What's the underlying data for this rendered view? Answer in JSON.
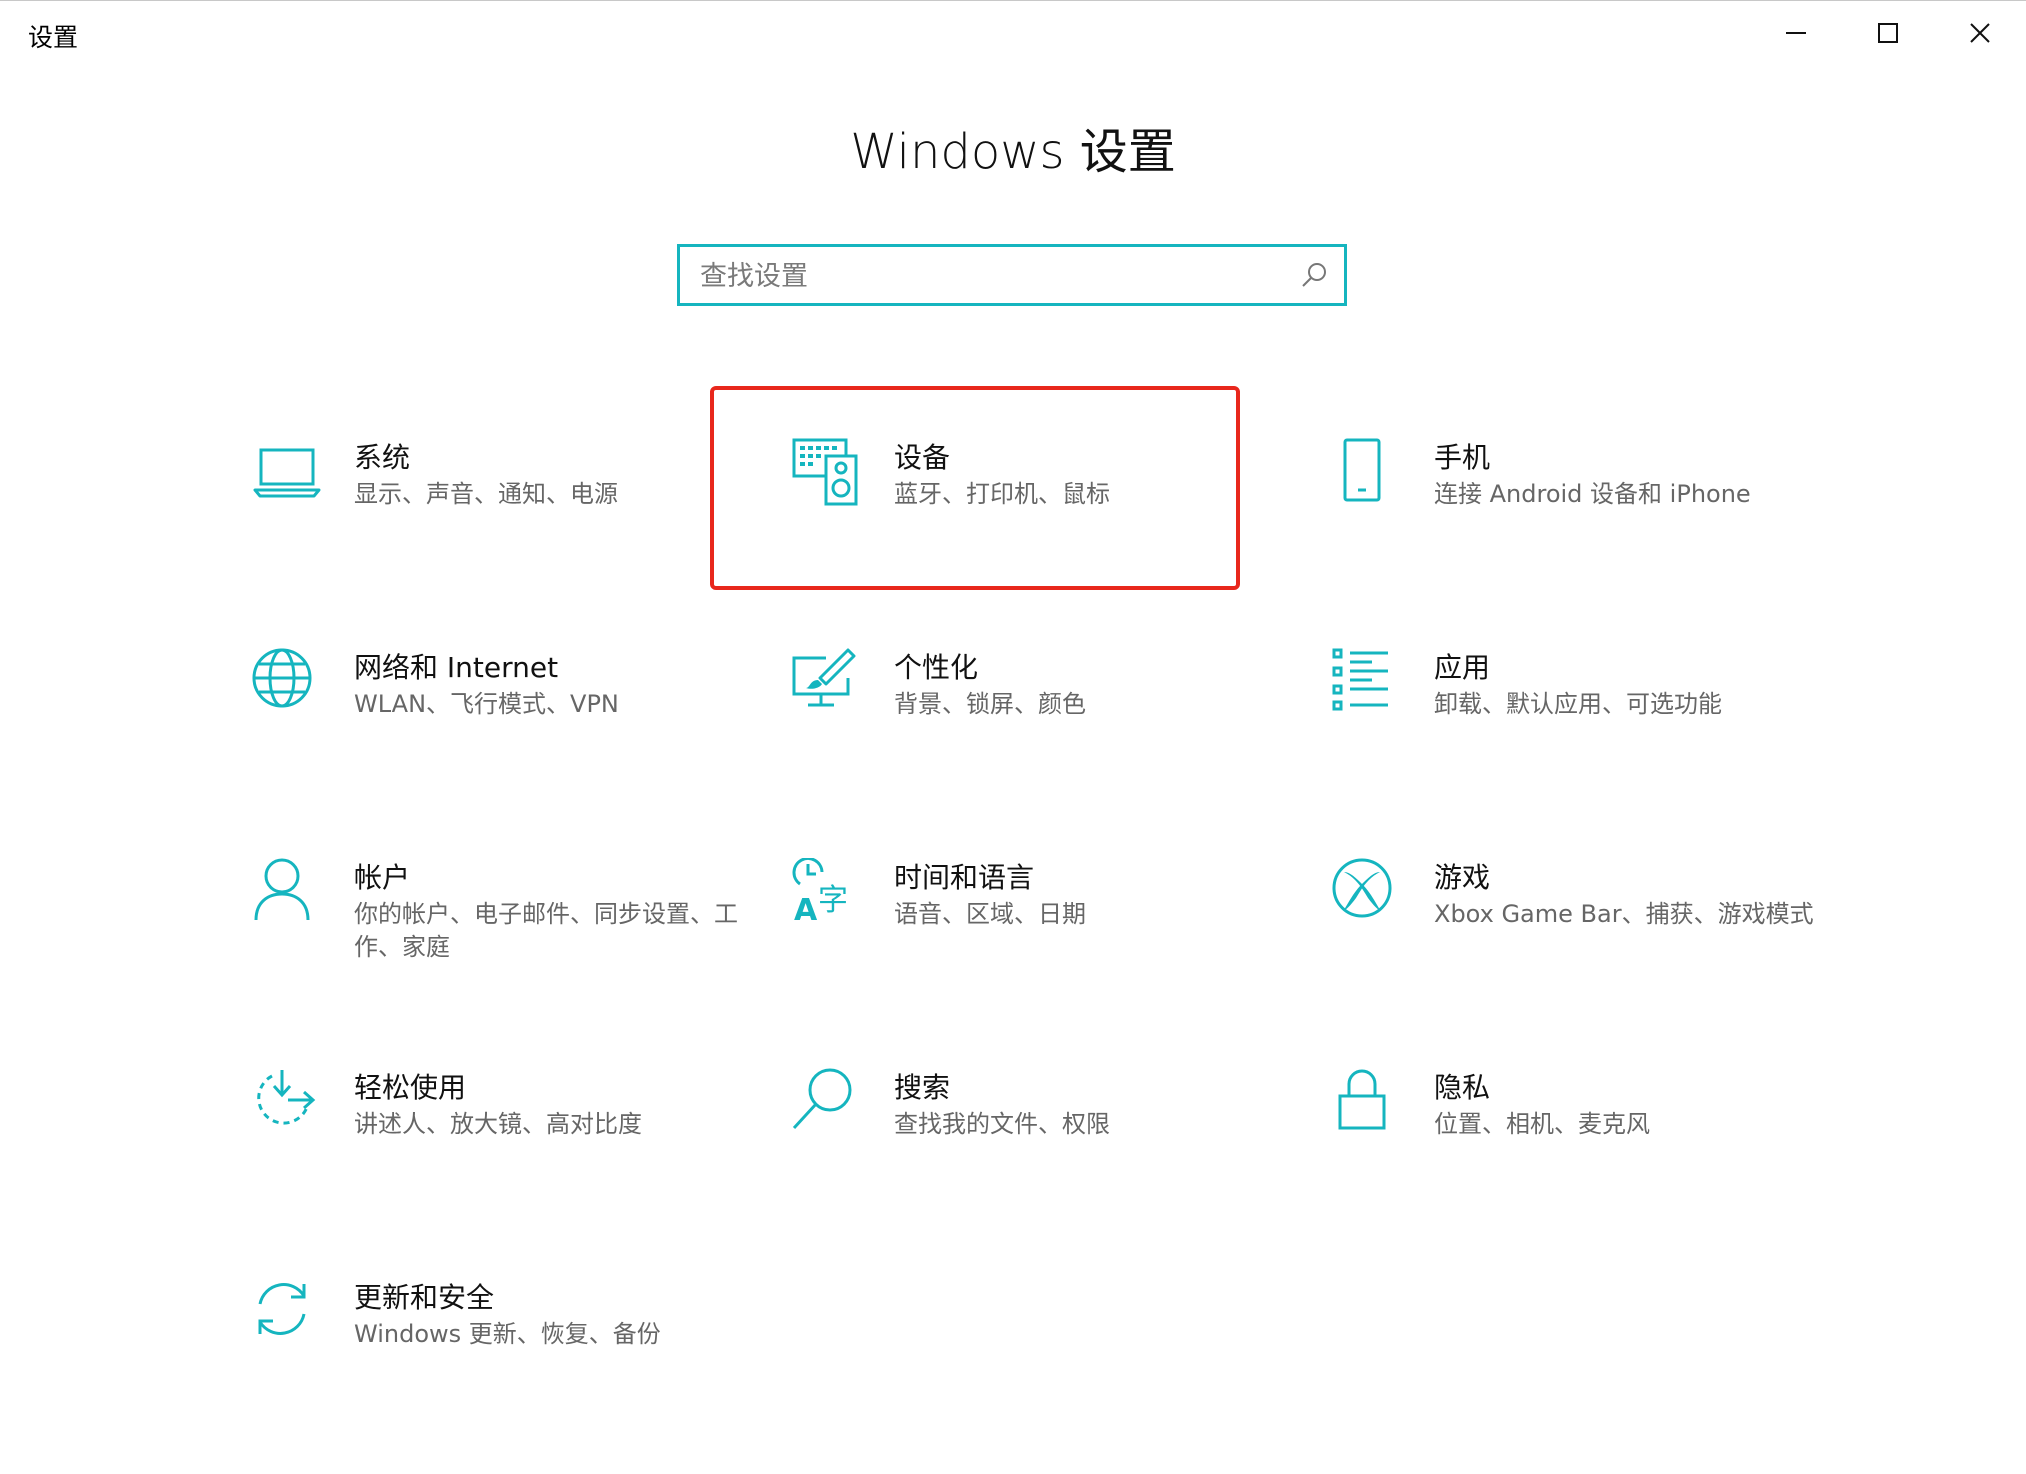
{
  "window": {
    "title": "设置"
  },
  "page": {
    "heading": "Windows 设置"
  },
  "search": {
    "placeholder": "查找设置"
  },
  "colors": {
    "accent": "#15b5bf",
    "highlight": "#e8271c"
  },
  "tiles": [
    {
      "icon": "laptop-icon",
      "title": "系统",
      "subtitle": "显示、声音、通知、电源"
    },
    {
      "icon": "keyboard-speaker-icon",
      "title": "设备",
      "subtitle": "蓝牙、打印机、鼠标"
    },
    {
      "icon": "phone-icon",
      "title": "手机",
      "subtitle": "连接 Android 设备和 iPhone"
    },
    {
      "icon": "globe-icon",
      "title": "网络和 Internet",
      "subtitle": "WLAN、飞行模式、VPN"
    },
    {
      "icon": "paintbrush-monitor-icon",
      "title": "个性化",
      "subtitle": "背景、锁屏、颜色"
    },
    {
      "icon": "app-list-icon",
      "title": "应用",
      "subtitle": "卸载、默认应用、可选功能"
    },
    {
      "icon": "person-icon",
      "title": "帐户",
      "subtitle": "你的帐户、电子邮件、同步设置、工作、家庭"
    },
    {
      "icon": "time-language-icon",
      "title": "时间和语言",
      "subtitle": "语音、区域、日期"
    },
    {
      "icon": "xbox-icon",
      "title": "游戏",
      "subtitle": "Xbox Game Bar、捕获、游戏模式"
    },
    {
      "icon": "accessibility-icon",
      "title": "轻松使用",
      "subtitle": "讲述人、放大镜、高对比度"
    },
    {
      "icon": "search-icon",
      "title": "搜索",
      "subtitle": "查找我的文件、权限"
    },
    {
      "icon": "lock-icon",
      "title": "隐私",
      "subtitle": "位置、相机、麦克风"
    },
    {
      "icon": "sync-icon",
      "title": "更新和安全",
      "subtitle": "Windows 更新、恢复、备份"
    }
  ]
}
